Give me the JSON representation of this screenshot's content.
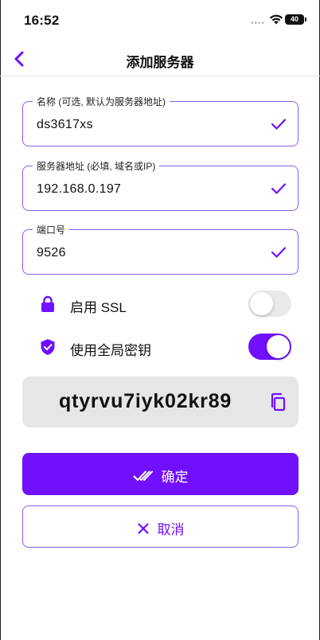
{
  "status_bar": {
    "time": "16:52",
    "dots": "••••",
    "battery": "40"
  },
  "nav": {
    "title": "添加服务器",
    "back_icon": "chevron-left-icon"
  },
  "colors": {
    "accent": "#7010ff",
    "field_border": "#8a5cf6",
    "toggle_off": "#e9e9eb",
    "key_bg": "#e6e6e6"
  },
  "fields": [
    {
      "label": "名称 (可选, 默认为服务器地址)",
      "value": "ds3617xs",
      "valid": true
    },
    {
      "label": "服务器地址 (必填, 域名或IP)",
      "value": "192.168.0.197",
      "valid": true
    },
    {
      "label": "端口号",
      "value": "9526",
      "valid": true
    }
  ],
  "options": [
    {
      "label": "启用 SSL",
      "icon": "lock-icon",
      "enabled": false
    },
    {
      "label": "使用全局密钥",
      "icon": "shield-check-icon",
      "enabled": true
    }
  ],
  "key": {
    "value": "qtyrvu7iyk02kr89",
    "copy_icon": "copy-icon"
  },
  "buttons": {
    "confirm": {
      "label": "确定",
      "icon": "double-check-icon"
    },
    "cancel": {
      "label": "取消",
      "icon": "close-icon"
    }
  }
}
